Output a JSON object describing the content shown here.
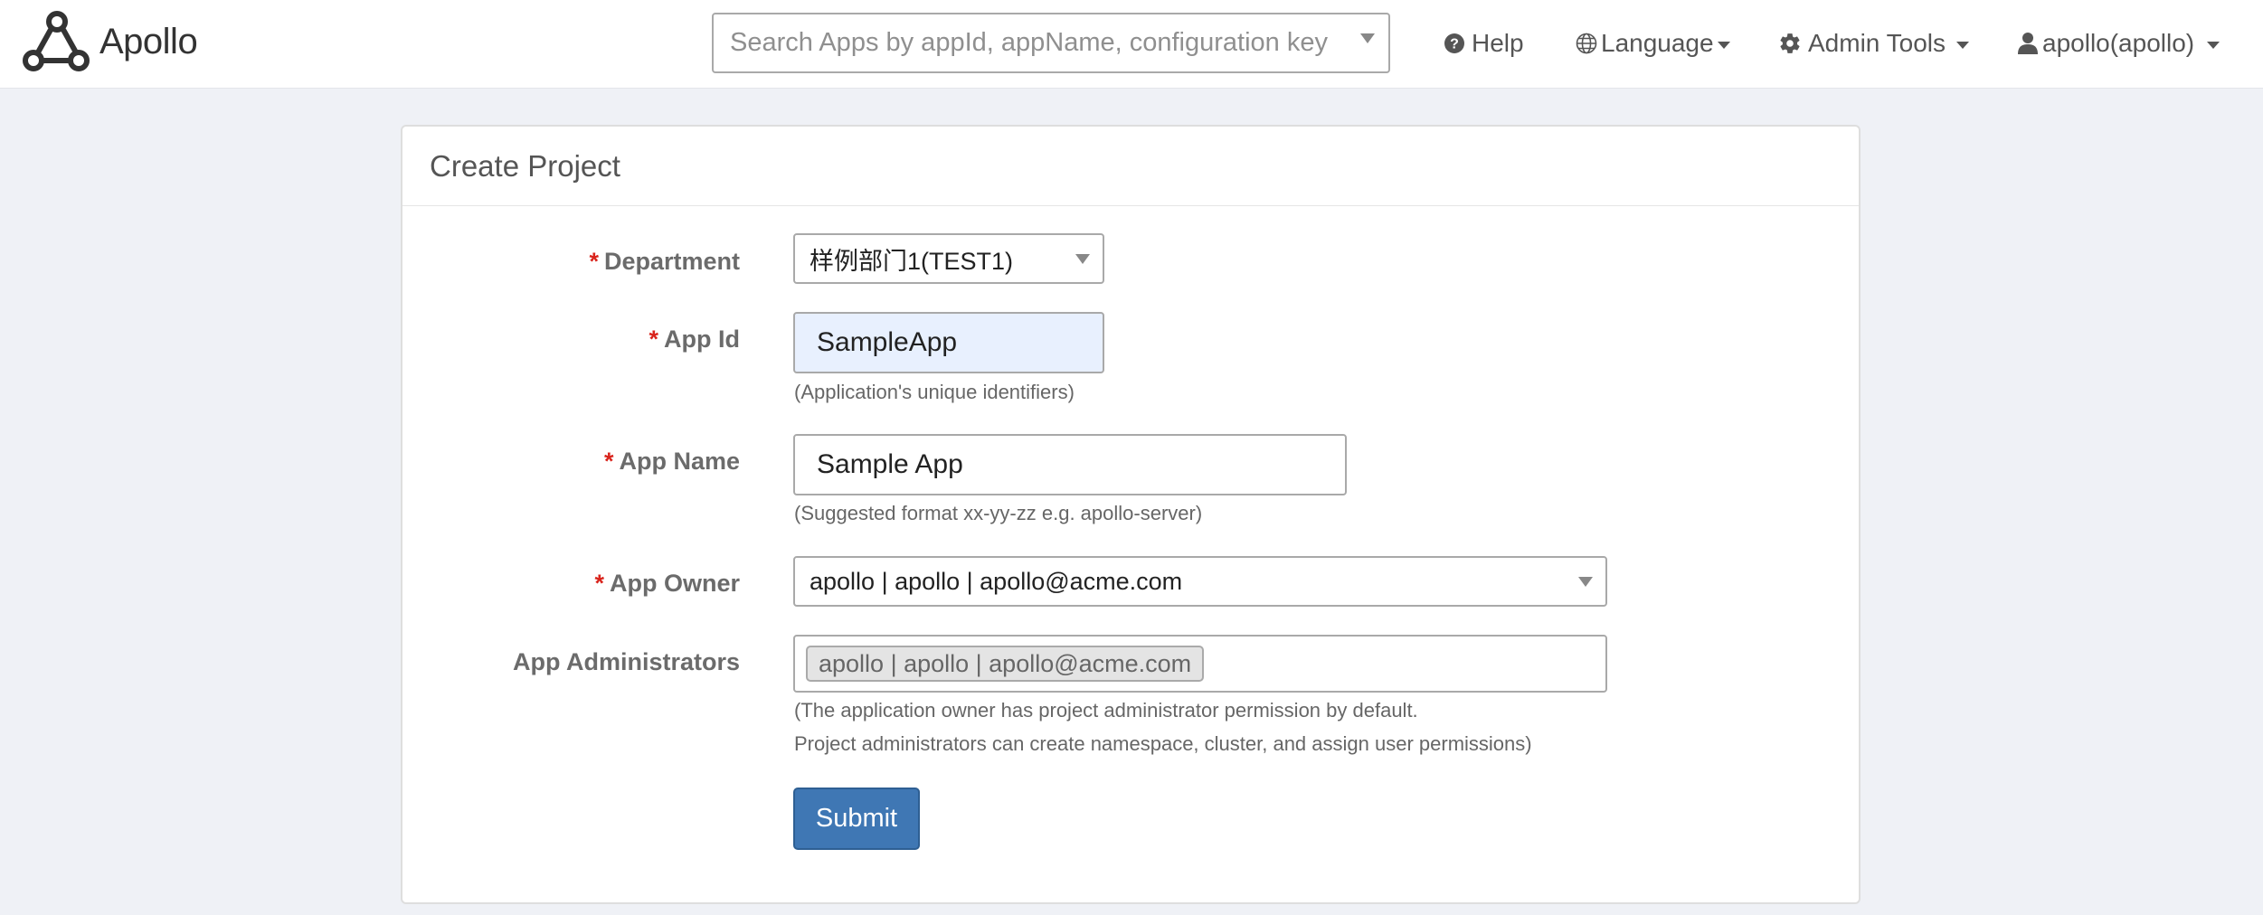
{
  "header": {
    "brand": "Apollo",
    "search": {
      "placeholder": "Search Apps by appId, appName, configuration key",
      "value": ""
    },
    "nav": {
      "help": "Help",
      "language": "Language",
      "admin_tools": "Admin Tools",
      "user": "apollo(apollo)"
    }
  },
  "form": {
    "title": "Create Project",
    "required_mark": "*",
    "department": {
      "label": "Department",
      "value": "样例部门1(TEST1)"
    },
    "app_id": {
      "label": "App Id",
      "value": "SampleApp",
      "help": "(Application's unique identifiers)"
    },
    "app_name": {
      "label": "App Name",
      "value": "Sample App",
      "help": "(Suggested format xx-yy-zz e.g. apollo-server)"
    },
    "app_owner": {
      "label": "App Owner",
      "value": "apollo | apollo | apollo@acme.com"
    },
    "app_admins": {
      "label": "App Administrators",
      "tags": [
        "apollo | apollo | apollo@acme.com"
      ],
      "help_line1": "(The application owner has project administrator permission by default.",
      "help_line2": "Project administrators can create namespace, cluster, and assign user permissions)"
    },
    "submit_label": "Submit"
  },
  "colors": {
    "page_bg": "#eff1f6",
    "primary": "#3f77b4",
    "required": "#d9241c",
    "autofill_bg": "#e8f0fe"
  },
  "icons": {
    "logo": "apollo-logo-icon",
    "help": "question-circle-icon",
    "language": "globe-icon",
    "admin": "gear-icon",
    "user": "user-icon"
  }
}
